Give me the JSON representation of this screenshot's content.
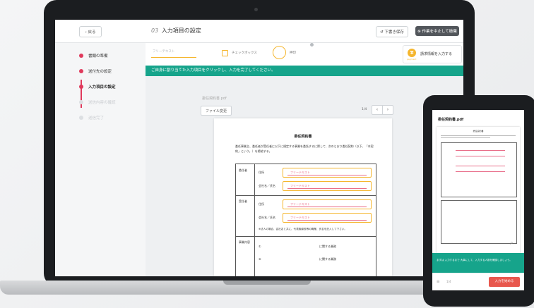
{
  "header": {
    "back_label": "‹ 戻る",
    "step_number": "03",
    "title": "入力項目の設定",
    "save_draft_label": "↺ 下書き保存",
    "stop_label": "⊗ 作業を中止して破棄"
  },
  "steps": [
    {
      "label": "書類の準備",
      "state": "done"
    },
    {
      "label": "送付先の設定",
      "state": "done"
    },
    {
      "label": "入力項目の設定",
      "state": "active"
    },
    {
      "label": "送信内容の確認",
      "state": "disabled"
    },
    {
      "label": "送信完了",
      "state": "disabled"
    }
  ],
  "toolbar": {
    "free_text_label": "フリーテキスト",
    "checkbox_label": "チェックボックス",
    "circle_label": "押印",
    "payment_icon_text": "¥",
    "payment_icon_sub": "payment",
    "payment_label": "請求情報を入力する"
  },
  "banner_text": "ご自身に割り当てた入力項目をクリックし、入力を完了してください。",
  "document": {
    "file_name": "委任契約書.pdf",
    "change_file_label": "ファイル変更",
    "page_indicator": "1/4",
    "prev_icon": "‹",
    "next_icon": "›",
    "title": "委任契約書",
    "body": "委任事業主、委任者が受任者に以下に規定する事業を委託するに際して、次のとおり委任契約（以下、「本契約」という。）を締結する。",
    "rows": {
      "delegator": "委任者",
      "delegatee": "受任者",
      "business": "事業内容",
      "address": "住所",
      "name": "会社名／氏名",
      "note": "※法人の場合、会社名と共に、代表取締役等の職業、氏名を記入して下さい。",
      "item": "に関する業務",
      "circle1": "①",
      "circle2": "②"
    },
    "field_text": "フリーテキスト"
  },
  "phone": {
    "title": "委任契約書.pdf",
    "doc_title": "委任契約書",
    "banner": "まずは 入力するまで 大事にして、入力する人数を確認しましょう。",
    "page": "1/4",
    "cta": "入力を始める",
    "menu_icon": "☰",
    "zoom_icon": "⌕"
  }
}
